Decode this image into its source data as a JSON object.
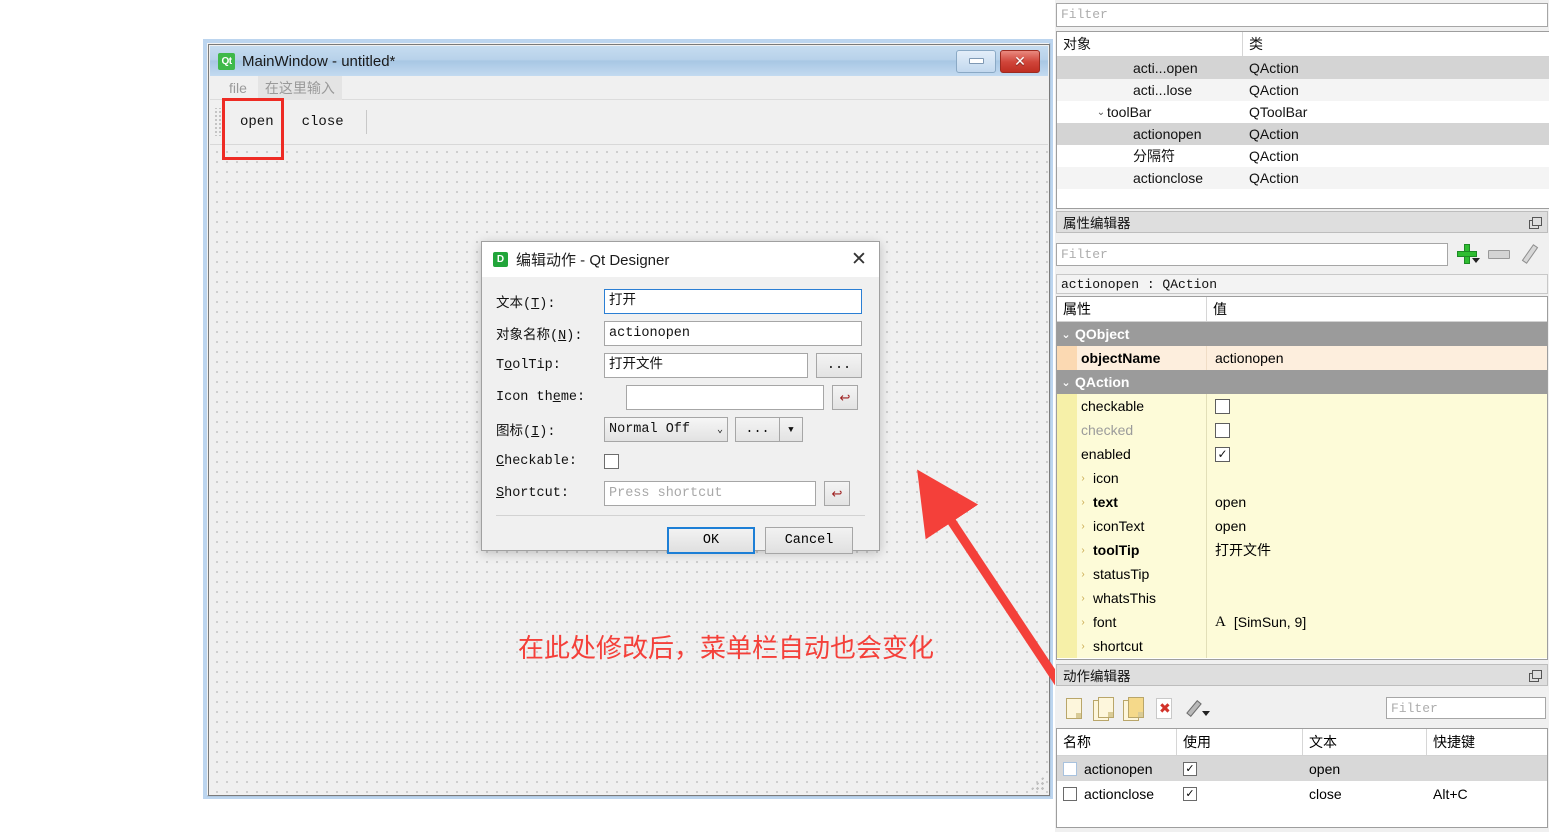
{
  "mainwindow": {
    "title": "MainWindow - untitled*",
    "icon": "Qt",
    "minimize_label": "",
    "close_label": "✕",
    "menubar": {
      "items": [
        "file"
      ],
      "placeholder": "在这里输入"
    },
    "toolbar": {
      "actions": [
        "open",
        "close"
      ]
    },
    "annotation": "在此处修改后，菜单栏自动也会变化"
  },
  "dialog": {
    "icon": "D",
    "title": "编辑动作 - Qt Designer",
    "close_label": "✕",
    "fields": {
      "text": {
        "label_prefix": "文本(",
        "label_key": "T",
        "label_suffix": "):",
        "value": "打开"
      },
      "object_name": {
        "label_prefix": "对象名称(",
        "label_key": "N",
        "label_suffix": "):",
        "value": "actionopen"
      },
      "tooltip": {
        "label_a": "T",
        "label_key": "o",
        "label_b": "olTip:",
        "value": "打开文件",
        "browse_label": "..."
      },
      "icon_theme": {
        "label_a": "Icon th",
        "label_key": "e",
        "label_b": "me:",
        "value": "",
        "reset_label": "↩"
      },
      "icon": {
        "label_prefix": "图标(",
        "label_key": "I",
        "label_suffix": "):",
        "value": "Normal Off",
        "browse_label": "...",
        "dropdown_label": "▼"
      },
      "checkable": {
        "label_key": "C",
        "label_rest": "heckable:",
        "checked": false
      },
      "shortcut": {
        "label_key": "S",
        "label_rest": "hortcut:",
        "placeholder": "Press shortcut",
        "value": "",
        "reset_label": "↩"
      }
    },
    "buttons": {
      "ok": "OK",
      "cancel": "Cancel"
    }
  },
  "object_inspector": {
    "filter_placeholder": "Filter",
    "columns": [
      "对象",
      "类"
    ],
    "rows": [
      {
        "name": "acti...open",
        "cls": "QAction",
        "indent": 2,
        "expandable": false,
        "selected": true
      },
      {
        "name": "acti...lose",
        "cls": "QAction",
        "indent": 2,
        "expandable": false,
        "selected": false
      },
      {
        "name": "toolBar",
        "cls": "QToolBar",
        "indent": 1,
        "expandable": true,
        "chev": "⌄",
        "selected": false
      },
      {
        "name": "actionopen",
        "cls": "QAction",
        "indent": 2,
        "expandable": false,
        "selected": true
      },
      {
        "name": "分隔符",
        "cls": "QAction",
        "indent": 2,
        "expandable": false,
        "selected": false
      },
      {
        "name": "actionclose",
        "cls": "QAction",
        "indent": 2,
        "expandable": false,
        "selected": false
      }
    ]
  },
  "property_editor": {
    "title": "属性编辑器",
    "filter_placeholder": "Filter",
    "object_line": "actionopen : QAction",
    "columns": [
      "属性",
      "值"
    ],
    "rows": [
      {
        "kind": "group",
        "name": "QObject",
        "chev": "⌄"
      },
      {
        "kind": "prop",
        "name": "objectName",
        "value": "actionopen",
        "bold": true,
        "style": "objname"
      },
      {
        "kind": "group",
        "name": "QAction",
        "chev": "⌄"
      },
      {
        "kind": "prop",
        "name": "checkable",
        "value": "",
        "control": "checkbox",
        "checked": false
      },
      {
        "kind": "prop",
        "name": "checked",
        "value": "",
        "control": "checkbox",
        "checked": false,
        "disabled": true
      },
      {
        "kind": "prop",
        "name": "enabled",
        "value": "",
        "control": "checkbox",
        "checked": true
      },
      {
        "kind": "prop",
        "name": "icon",
        "value": "",
        "chev": "›"
      },
      {
        "kind": "prop",
        "name": "text",
        "value": "open",
        "bold": true,
        "chev": "›"
      },
      {
        "kind": "prop",
        "name": "iconText",
        "value": "open",
        "chev": "›"
      },
      {
        "kind": "prop",
        "name": "toolTip",
        "value": "打开文件",
        "bold": true,
        "chev": "›"
      },
      {
        "kind": "prop",
        "name": "statusTip",
        "value": "",
        "chev": "›"
      },
      {
        "kind": "prop",
        "name": "whatsThis",
        "value": "",
        "chev": "›"
      },
      {
        "kind": "prop",
        "name": "font",
        "value": "[SimSun, 9]",
        "chev": "›",
        "control": "font"
      },
      {
        "kind": "prop",
        "name": "shortcut",
        "value": "",
        "chev": "›"
      }
    ]
  },
  "action_editor": {
    "title": "动作编辑器",
    "filter_placeholder": "Filter",
    "toolbar_icons": [
      "new-action-icon",
      "copy-action-icon",
      "paste-action-icon",
      "delete-action-icon",
      "configure-icon"
    ],
    "columns": [
      "名称",
      "使用",
      "文本",
      "快捷键"
    ],
    "rows": [
      {
        "name": "actionopen",
        "used": true,
        "text": "open",
        "shortcut": "",
        "selected": true
      },
      {
        "name": "actionclose",
        "used": true,
        "text": "close",
        "shortcut": "Alt+C",
        "selected": false
      }
    ]
  },
  "colors": {
    "annotation_red": "#f4403a",
    "highlight_red": "#ee2b24",
    "focus_blue": "#1d7fd6",
    "group_gray": "#9b9b9b",
    "prop_yellow": "#fdfbd8",
    "objname_orange": "#fdeedd"
  }
}
